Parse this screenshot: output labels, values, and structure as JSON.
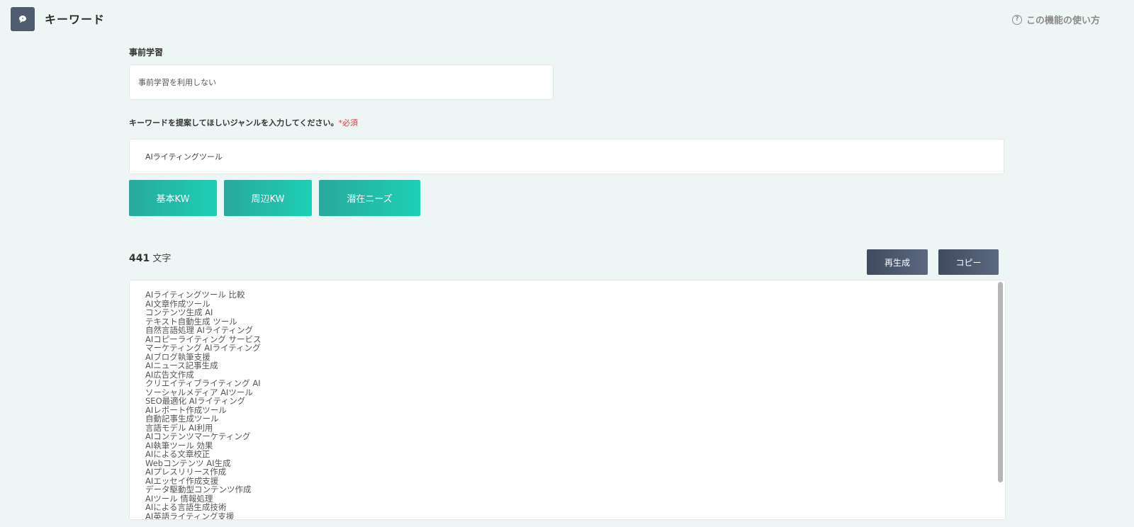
{
  "header": {
    "title": "キーワード",
    "help_label": "この機能の使い方",
    "help_icon_glyph": "?"
  },
  "form": {
    "pretrain_label": "事前学習",
    "pretrain_value": "事前学習を利用しない",
    "genre_label": "キーワードを提案してほしいジャンルを入力してください。",
    "required_mark": "*必須",
    "genre_value": "AIライティングツール"
  },
  "buttons": {
    "basic_kw": "基本KW",
    "around_kw": "周辺KW",
    "latent_needs": "潜在ニーズ",
    "regenerate": "再生成",
    "copy": "コピー"
  },
  "result": {
    "char_count": "441",
    "char_unit": " 文字",
    "lines": [
      "AIライティングツール 比較",
      "AI文章作成ツール",
      "コンテンツ生成 AI",
      "テキスト自動生成 ツール",
      "自然言語処理 AIライティング",
      "AIコピーライティング サービス",
      "マーケティング AIライティング",
      "AIブログ執筆支援",
      "AIニュース記事生成",
      "AI広告文作成",
      "クリエイティブライティング AI",
      "ソーシャルメディア AIツール",
      "SEO最適化 AIライティング",
      "AIレポート作成ツール",
      "自動記事生成ツール",
      "言語モデル AI利用",
      "AIコンテンツマーケティング",
      "AI執筆ツール 効果",
      "AIによる文章校正",
      "Webコンテンツ AI生成",
      "AIプレスリリース作成",
      "AIエッセイ作成支援",
      "データ駆動型コンテンツ作成",
      "AIツール 情報処理",
      "AIによる言語生成技術",
      "AI英語ライティング支援"
    ]
  },
  "colors": {
    "background": "#eef6f5",
    "teal_button_start": "#28a99b",
    "teal_button_end": "#1ecfb5",
    "dark_button": "#404b5e",
    "required": "#e23b3b"
  },
  "icons": {
    "app_icon": "speech-bubble-icon",
    "help_icon": "question-circle-icon"
  }
}
